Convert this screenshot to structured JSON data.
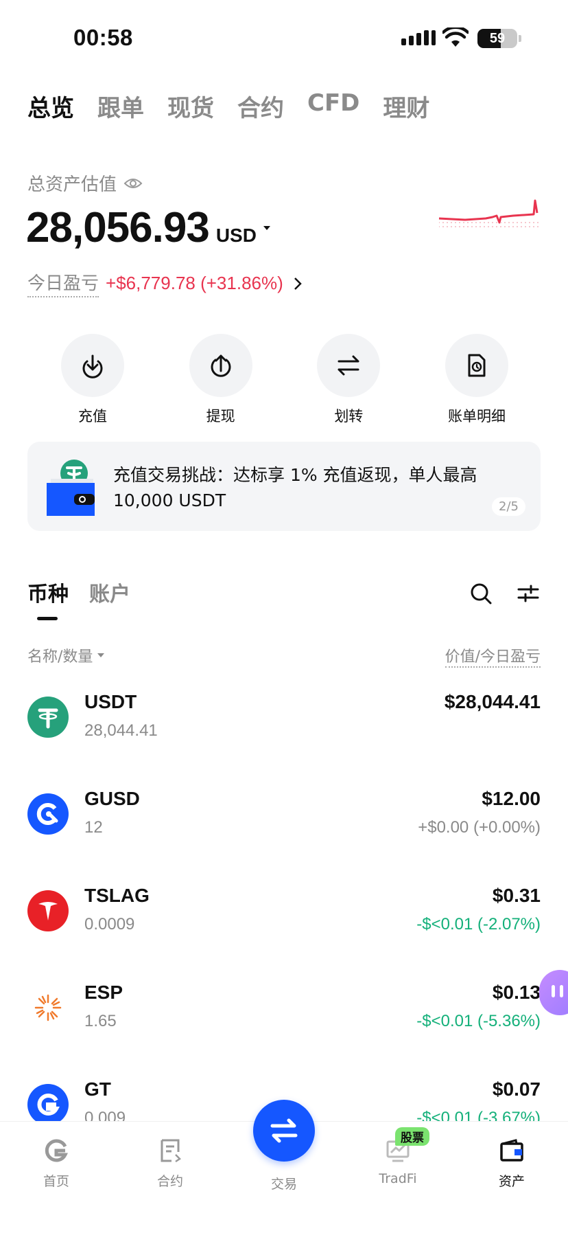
{
  "status": {
    "time": "00:58",
    "battery": "59",
    "battery_level": 0.59
  },
  "top_tabs": [
    "总览",
    "跟单",
    "现货",
    "合约",
    "CFD",
    "理财"
  ],
  "summary": {
    "label": "总资产估值",
    "value": "28,056.93",
    "currency": "USD",
    "pnl_label": "今日盈亏",
    "pnl_value": "+$6,779.78 (+31.86%)"
  },
  "actions": [
    {
      "label": "充值",
      "icon": "deposit-icon"
    },
    {
      "label": "提现",
      "icon": "withdraw-icon"
    },
    {
      "label": "划转",
      "icon": "transfer-icon"
    },
    {
      "label": "账单明细",
      "icon": "bill-icon"
    }
  ],
  "banner": {
    "text": "充值交易挑战：达标享 1% 充值返现，单人最高 10,000 USDT",
    "page": "2/5"
  },
  "section_tabs": [
    "币种",
    "账户"
  ],
  "list_header": {
    "left": "名称/数量",
    "right": "价值/今日盈亏"
  },
  "assets": [
    {
      "name": "USDT",
      "qty": "28,044.41",
      "value": "$28,044.41",
      "change": "",
      "trend": "neutral",
      "icon": "usdt-icon",
      "color": "#26a17b"
    },
    {
      "name": "GUSD",
      "qty": "12",
      "value": "$12.00",
      "change": "+$0.00 (+0.00%)",
      "trend": "neutral",
      "icon": "gusd-icon",
      "color": "#1557ff"
    },
    {
      "name": "TSLAG",
      "qty": "0.0009",
      "value": "$0.31",
      "change": "-$<0.01 (-2.07%)",
      "trend": "down",
      "icon": "tesla-icon",
      "color": "#e82127"
    },
    {
      "name": "ESP",
      "qty": "1.65",
      "value": "$0.13",
      "change": "-$<0.01 (-5.36%)",
      "trend": "down",
      "icon": "esp-icon",
      "color": "#f07a2c"
    },
    {
      "name": "GT",
      "qty": "0.009",
      "value": "$0.07",
      "change": "-$<0.01 (-3.67%)",
      "trend": "down",
      "icon": "gt-icon",
      "color": "#1557ff"
    }
  ],
  "bottom_nav": {
    "items": [
      "首页",
      "合约",
      "交易",
      "TradFi",
      "资产"
    ],
    "badge": "股票",
    "active_index": 4
  },
  "colors": {
    "positive": "#e8344f",
    "negative": "#14b07a",
    "accent": "#1557ff"
  }
}
